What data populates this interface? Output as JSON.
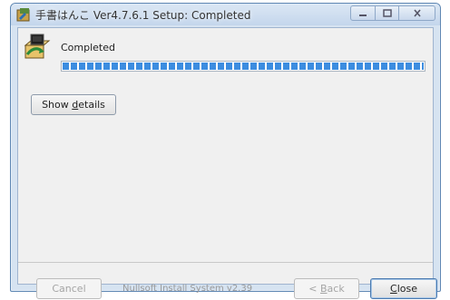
{
  "window": {
    "title": "手書はんこ Ver4.7.6.1 Setup: Completed",
    "app_icon": "installer-app-icon",
    "controls": [
      "minimize-icon",
      "maximize-icon",
      "close-icon"
    ]
  },
  "header": {
    "icon": "installer-box-icon",
    "status": "Completed"
  },
  "progress": {
    "value_percent": 100,
    "color": "#3d8de0"
  },
  "details_button": {
    "prefix": "Show ",
    "accel": "d",
    "suffix": "etails"
  },
  "footer": {
    "branding": "Nullsoft Install System v2.39",
    "cancel_label": "Cancel",
    "back_prefix": "< ",
    "back_accel": "B",
    "back_suffix": "ack",
    "close_accel": "C",
    "close_suffix": "lose"
  },
  "colors": {
    "accent": "#3d8de0",
    "window_frame": "#d6e3f1"
  }
}
